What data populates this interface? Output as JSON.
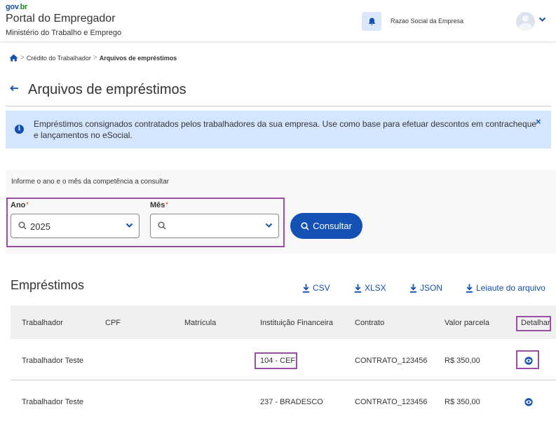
{
  "header": {
    "logo": {
      "part1": "gov",
      "part2": ".",
      "part3": "br"
    },
    "portal_title": "Portal do Empregador",
    "ministry": "Ministério do Trabalho e Emprego",
    "company_name": "Razao Social da Empresa"
  },
  "breadcrumb": {
    "items": [
      {
        "label": "Crédito do Trabalhador"
      },
      {
        "label": "Arquivos de empréstimos"
      }
    ]
  },
  "page": {
    "title": "Arquivos de empréstimos"
  },
  "alert": {
    "text": "Empréstimos consignados contratados pelos trabalhadores da sua empresa. Use como base para efetuar descontos em contracheque e lançamentos no eSocial.",
    "close": "×"
  },
  "filter": {
    "heading": "Informe o ano e o mês da competência a consultar",
    "year_label": "Ano",
    "year_value": "2025",
    "month_label": "Mês",
    "month_value": "",
    "required_mark": "*",
    "consult_label": "Consultar"
  },
  "loans": {
    "title": "Empréstimos",
    "downloads": [
      "CSV",
      "XLSX",
      "JSON",
      "Leiaute do arquivo"
    ],
    "columns": [
      "Trabalhador",
      "CPF",
      "Matrícula",
      "Instituição Financeira",
      "Contrato",
      "Valor parcela",
      "Detalhar"
    ],
    "rows": [
      {
        "worker": "Trabalhador Teste",
        "cpf": "",
        "registration": "",
        "institution": "104 - CEF",
        "contract": "CONTRATO_123456",
        "installment": "R$ 350,00"
      },
      {
        "worker": "Trabalhador Teste",
        "cpf": "",
        "registration": "",
        "institution": "237 - BRADESCO",
        "contract": "CONTRATO_123456",
        "installment": "R$ 350,00"
      }
    ]
  },
  "colors": {
    "primary": "#1351b4",
    "alert_bg": "#d4e5ff",
    "highlight": "#9b4ea6",
    "required": "#e52207"
  }
}
